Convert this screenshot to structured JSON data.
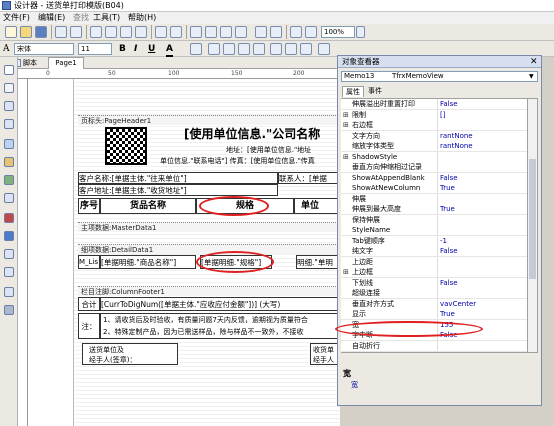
{
  "app": {
    "title": "设计器 - 送货单打印模版(B04)"
  },
  "window_buttons": {
    "min": "—",
    "max": "□",
    "close": "✕"
  },
  "menu": [
    "文件(F)",
    "编辑(E)",
    "查找",
    "工具(T)",
    "帮助(H)"
  ],
  "toolbar2": {
    "font": "宋体",
    "size": "11",
    "zoom": "100%"
  },
  "tabs": {
    "script": "脚本",
    "page": "Page1"
  },
  "canvas": {
    "page_header": "页标头:PageHeader1",
    "title_text": "[使用单位信息.\"公司名称",
    "addr1": "地址：[使用单位信息.\"地址",
    "phone_line": "单位信息.\"联系电话\"] 传真：[使用单位信息.\"传真",
    "customer_name": "客户名称:[单据主体.\"往来单位\"]",
    "contact": "联系人：[单据",
    "customer_addr": "客户地址:[单据主体.\"收货地址\"]",
    "hdr_seq": "序号",
    "hdr_name": "货品名称",
    "hdr_spec": "规格",
    "hdr_unit": "单位",
    "master_band": "主项数据:MasterData1",
    "detail_band": "细项数据:DetailData1",
    "detail_left": "M_Lis",
    "detail_name": "[单据明细.\"商品名称\"]",
    "detail_spec": "[单据明细.\"规格\"]",
    "detail_right": "明细.\"单明",
    "column_footer": "栏目注脚:ColumnFooter1",
    "total_label": "合计",
    "total_text": "[CurrToDigNum([单据主体.\"应收应付金额\"])] (大写)",
    "note_label": "注：",
    "note1": "1、请收货后及时验收，有质量问题7天内反馈，逾期视为质量符合",
    "note2": "2、特殊定制产品，因为已需送样品，除与样品不一致外，不接收",
    "sign_left1": "送货单位及",
    "sign_left2": "经手人(签章)：",
    "sign_right1": "收货单",
    "sign_right2": "经手人"
  },
  "inspector": {
    "title": "对象查看器",
    "object_name": "Memo13",
    "object_type": "TfrxMemoView",
    "tab_props": "属性",
    "tab_events": "事件",
    "rows": [
      {
        "ex": "",
        "name": "伸展溢出时重置打印",
        "value": "False"
      },
      {
        "ex": "⊞",
        "name": "限制",
        "value": "[]"
      },
      {
        "ex": "⊞",
        "name": "右边框",
        "value": ""
      },
      {
        "ex": "",
        "name": "文字方向",
        "value": "rantNone"
      },
      {
        "ex": "",
        "name": "缩放字体类型",
        "value": "rantNone"
      },
      {
        "ex": "⊞",
        "name": "ShadowStyle",
        "value": ""
      },
      {
        "ex": "",
        "name": "垂直方向伸缩相过记录",
        "value": ""
      },
      {
        "ex": "",
        "name": "ShowAtAppendBlank",
        "value": "False"
      },
      {
        "ex": "",
        "name": "ShowAtNewColumn",
        "value": "True"
      },
      {
        "ex": "",
        "name": "伸展",
        "value": ""
      },
      {
        "ex": "",
        "name": "伸展到最大高度",
        "value": "True"
      },
      {
        "ex": "",
        "name": "保持伸展",
        "value": ""
      },
      {
        "ex": "",
        "name": "StyleName",
        "value": ""
      },
      {
        "ex": "",
        "name": "Tab键顺序",
        "value": "-1"
      },
      {
        "ex": "",
        "name": "纯文字",
        "value": "False"
      },
      {
        "ex": "",
        "name": "上边距",
        "value": ""
      },
      {
        "ex": "⊞",
        "name": "上边框",
        "value": ""
      },
      {
        "ex": "",
        "name": "下划线",
        "value": "False"
      },
      {
        "ex": "",
        "name": "超级连接",
        "value": ""
      },
      {
        "ex": "",
        "name": "垂直对齐方式",
        "value": "vavCenter"
      },
      {
        "ex": "",
        "name": "显示",
        "value": "True"
      },
      {
        "ex": "",
        "name": "宽",
        "value": "155"
      },
      {
        "ex": "",
        "name": "字中断",
        "value": "False"
      },
      {
        "ex": "",
        "name": "自动折行",
        "value": ""
      }
    ],
    "desc_title": "宽",
    "desc_text": "宽"
  },
  "colors": {
    "title_bar": "#0a246a",
    "accent_ring": "#e02020",
    "value_text": "#0000aa"
  }
}
